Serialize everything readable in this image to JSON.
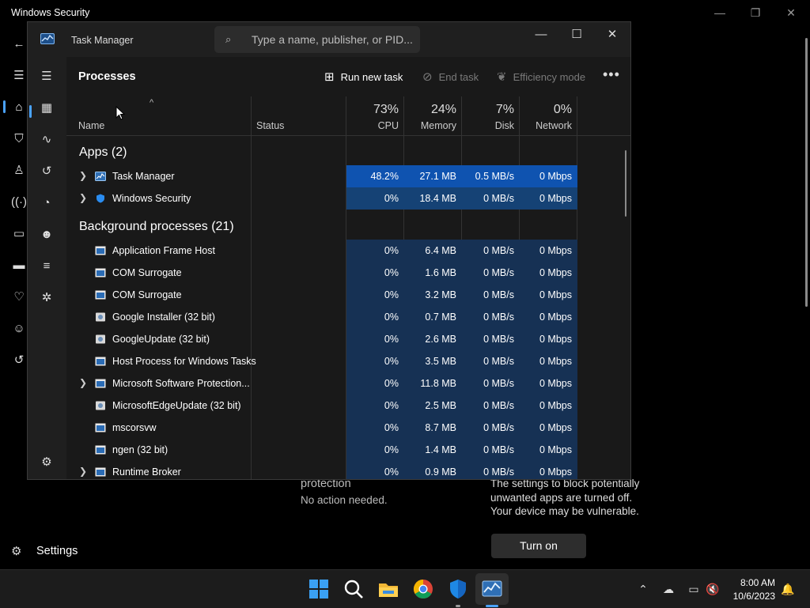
{
  "background_app": {
    "title": "Windows Security",
    "controls": {
      "minimize": "—",
      "maximize": "❐",
      "close": "✕"
    },
    "nav_icons": [
      "back-arrow-icon",
      "hamburger-menu-icon",
      "home-icon",
      "shield-icon",
      "person-icon",
      "network-icon",
      "app-browser-icon",
      "device-security-icon",
      "health-heart-icon",
      "family-icon",
      "history-icon"
    ],
    "settings_label": "Settings",
    "protection_text": "protection",
    "no_action_text": "No action needed.",
    "pua_text": "The settings to block potentially unwanted apps are turned off. Your device may be vulnerable.",
    "turn_on_label": "Turn on"
  },
  "task_manager": {
    "title": "Task Manager",
    "search_placeholder": "Type a name, publisher, or PID...",
    "controls": {
      "minimize": "—",
      "maximize": "☐",
      "close": "✕"
    },
    "page_title": "Processes",
    "toolbar": {
      "run_new_task": "Run new task",
      "end_task": "End task",
      "efficiency_mode": "Efficiency mode",
      "more": "•••"
    },
    "columns": {
      "name": "Name",
      "status": "Status",
      "cpu": {
        "pct": "73%",
        "label": "CPU"
      },
      "memory": {
        "pct": "24%",
        "label": "Memory"
      },
      "disk": {
        "pct": "7%",
        "label": "Disk"
      },
      "network": {
        "pct": "0%",
        "label": "Network"
      }
    },
    "groups": {
      "apps": "Apps (2)",
      "background": "Background processes (21)"
    },
    "apps": [
      {
        "name": "Task Manager",
        "cpu": "48.2%",
        "memory": "27.1 MB",
        "disk": "0.5 MB/s",
        "network": "0 Mbps",
        "expandable": true
      },
      {
        "name": "Windows Security",
        "cpu": "0%",
        "memory": "18.4 MB",
        "disk": "0 MB/s",
        "network": "0 Mbps",
        "expandable": true
      }
    ],
    "background": [
      {
        "name": "Application Frame Host",
        "cpu": "0%",
        "memory": "6.4 MB",
        "disk": "0 MB/s",
        "network": "0 Mbps",
        "expandable": false
      },
      {
        "name": "COM Surrogate",
        "cpu": "0%",
        "memory": "1.6 MB",
        "disk": "0 MB/s",
        "network": "0 Mbps",
        "expandable": false
      },
      {
        "name": "COM Surrogate",
        "cpu": "0%",
        "memory": "3.2 MB",
        "disk": "0 MB/s",
        "network": "0 Mbps",
        "expandable": false
      },
      {
        "name": "Google Installer (32 bit)",
        "cpu": "0%",
        "memory": "0.7 MB",
        "disk": "0 MB/s",
        "network": "0 Mbps",
        "expandable": false
      },
      {
        "name": "GoogleUpdate (32 bit)",
        "cpu": "0%",
        "memory": "2.6 MB",
        "disk": "0 MB/s",
        "network": "0 Mbps",
        "expandable": false
      },
      {
        "name": "Host Process for Windows Tasks",
        "cpu": "0%",
        "memory": "3.5 MB",
        "disk": "0 MB/s",
        "network": "0 Mbps",
        "expandable": false
      },
      {
        "name": "Microsoft Software Protection...",
        "cpu": "0%",
        "memory": "11.8 MB",
        "disk": "0 MB/s",
        "network": "0 Mbps",
        "expandable": true
      },
      {
        "name": "MicrosoftEdgeUpdate (32 bit)",
        "cpu": "0%",
        "memory": "2.5 MB",
        "disk": "0 MB/s",
        "network": "0 Mbps",
        "expandable": false
      },
      {
        "name": "mscorsvw",
        "cpu": "0%",
        "memory": "8.7 MB",
        "disk": "0 MB/s",
        "network": "0 Mbps",
        "expandable": false
      },
      {
        "name": "ngen (32 bit)",
        "cpu": "0%",
        "memory": "1.4 MB",
        "disk": "0 MB/s",
        "network": "0 Mbps",
        "expandable": false
      },
      {
        "name": "Runtime Broker",
        "cpu": "0%",
        "memory": "0.9 MB",
        "disk": "0 MB/s",
        "network": "0 Mbps",
        "expandable": true
      }
    ]
  },
  "taskbar": {
    "time": "8:00 AM",
    "date": "10/6/2023",
    "pinned": [
      "windows-start-icon",
      "search-icon",
      "file-explorer-icon",
      "chrome-icon",
      "windows-security-icon",
      "task-manager-icon"
    ]
  },
  "colors": {
    "accent": "#4aa3ff",
    "heat_low": "#163154",
    "heat_mid": "#154275",
    "heat_high": "#0f53b0"
  }
}
